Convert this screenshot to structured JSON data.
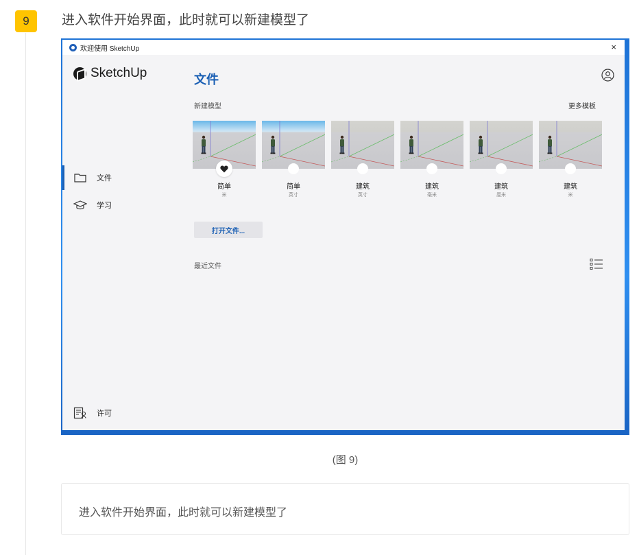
{
  "step": {
    "number": "9",
    "title": "进入软件开始界面，此时就可以新建模型了"
  },
  "window": {
    "title": "欢迎使用 SketchUp",
    "close_label": "×"
  },
  "app": {
    "brand": "SketchUp",
    "accent": "#1a5fb4"
  },
  "sidebar": {
    "items": [
      {
        "label": "文件",
        "icon": "folder-icon",
        "active": true
      },
      {
        "label": "学习",
        "icon": "graduation-cap-icon",
        "active": false
      }
    ],
    "footer_label": "许可",
    "footer_icon": "license-icon"
  },
  "main": {
    "title": "文件",
    "new_model_label": "新建模型",
    "more_templates_label": "更多模板",
    "templates": [
      {
        "name": "简单",
        "unit": "米",
        "favorite": true,
        "sky": true
      },
      {
        "name": "简单",
        "unit": "英寸",
        "favorite": false,
        "sky": true
      },
      {
        "name": "建筑",
        "unit": "英寸",
        "favorite": false,
        "sky": false
      },
      {
        "name": "建筑",
        "unit": "毫米",
        "favorite": false,
        "sky": false
      },
      {
        "name": "建筑",
        "unit": "厘米",
        "favorite": false,
        "sky": false
      },
      {
        "name": "建筑",
        "unit": "米",
        "favorite": false,
        "sky": false
      }
    ],
    "open_file_label": "打开文件...",
    "recent_files_label": "最近文件"
  },
  "caption": "(图 9)",
  "note": "进入软件开始界面，此时就可以新建模型了"
}
